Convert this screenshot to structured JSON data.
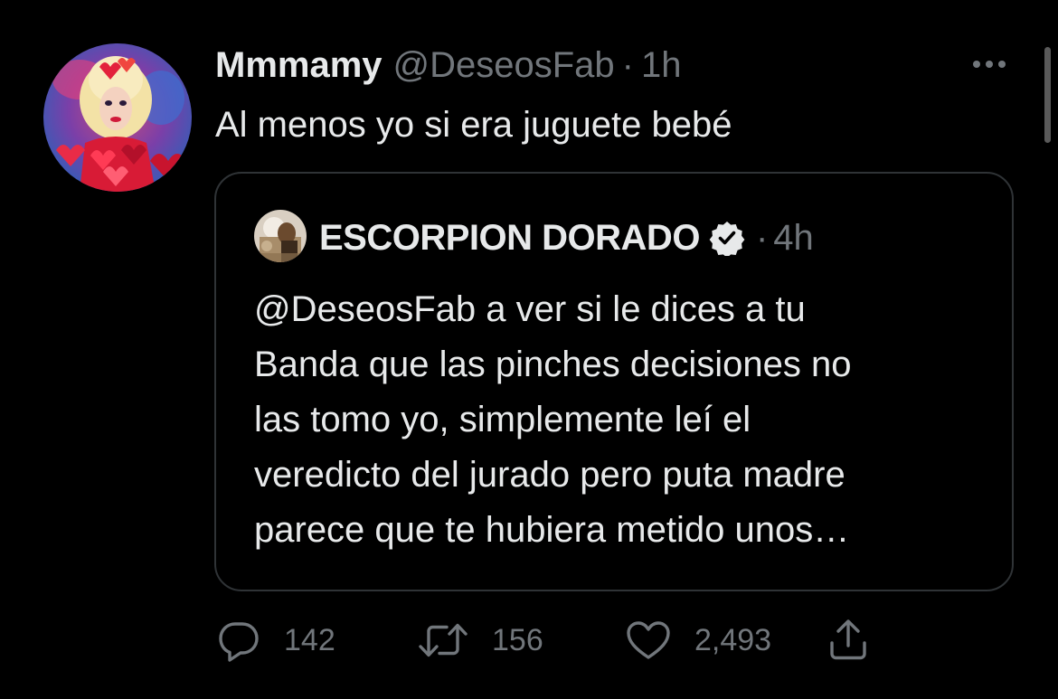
{
  "tweet": {
    "display_name": "Mmmamy",
    "handle": "@DeseosFab",
    "separator": "·",
    "time": "1h",
    "text": "Al menos yo si era juguete bebé",
    "avatar_icon": "profile-avatar"
  },
  "quoted_tweet": {
    "display_name": "ESCORPION DORADO",
    "verified": true,
    "separator": "·",
    "time": "4h",
    "text_lines": [
      "@DeseosFab a ver si le dices a tu",
      "Banda que las pinches decisiones no",
      "las tomo yo, simplemente leí el",
      "veredicto del jurado pero puta madre",
      "parece que te hubiera metido unos…"
    ]
  },
  "actions": {
    "reply_count": "142",
    "retweet_count": "156",
    "like_count": "2,493"
  },
  "icons": {
    "reply": "reply-icon",
    "retweet": "retweet-icon",
    "like": "heart-icon",
    "share": "share-icon",
    "more": "more-options-icon",
    "verified": "verified-badge-icon"
  },
  "colors": {
    "background": "#000000",
    "text_primary": "#e7e9ea",
    "text_secondary": "#71767b",
    "border": "#2f3336"
  }
}
